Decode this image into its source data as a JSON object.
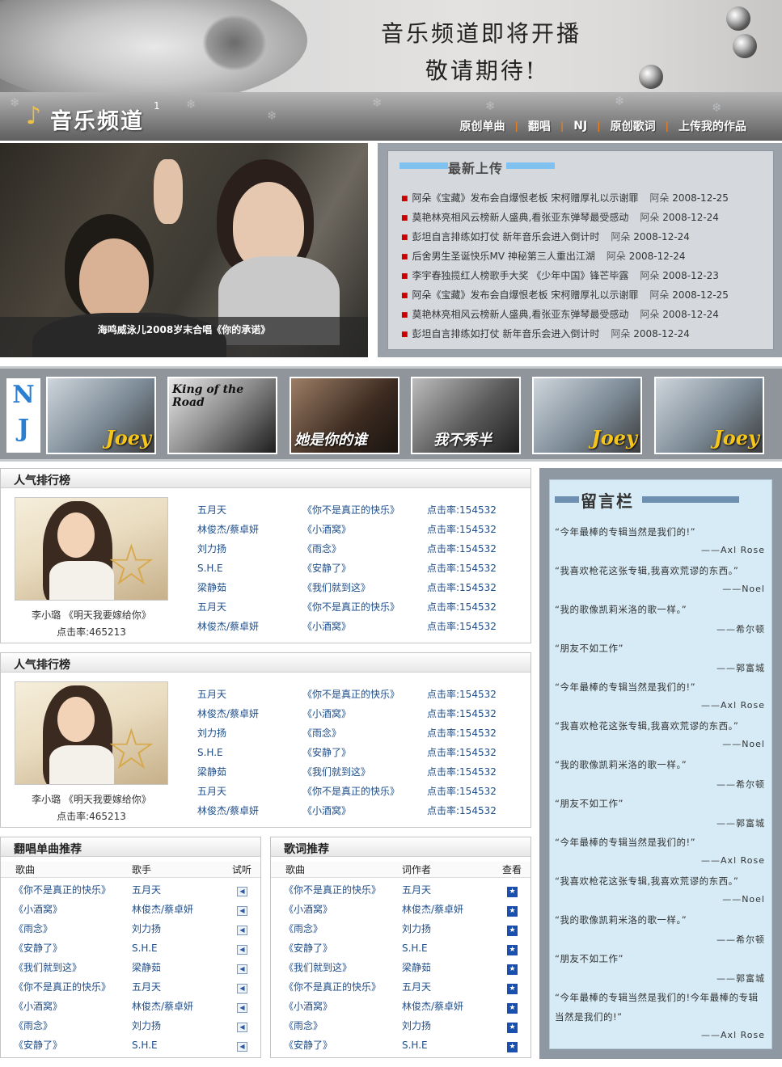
{
  "banner": {
    "line1": "音乐频道即将开播",
    "line2": "敬请期待!"
  },
  "nav": {
    "logo": "音乐频道",
    "logo_sup": "1",
    "links": [
      "原创单曲",
      "翻唱",
      "NJ",
      "原创歌词",
      "上传我的作品"
    ]
  },
  "hero": {
    "caption": "海鸣威泳儿2008岁末合唱《你的承诺》"
  },
  "latest": {
    "title": "最新上传",
    "items": [
      {
        "text": "阿朵《宝藏》发布会自爆恨老板 宋柯赠厚礼以示谢罪",
        "author": "阿朵",
        "date": "2008-12-25"
      },
      {
        "text": "莫艳林亮相风云榜新人盛典,看张亚东弹琴最受感动",
        "author": "阿朵",
        "date": "2008-12-24"
      },
      {
        "text": "彭坦自言排练如打仗 新年音乐会进入倒计时",
        "author": "阿朵",
        "date": "2008-12-24"
      },
      {
        "text": "后舍男生圣诞快乐MV 神秘第三人重出江湖",
        "author": "阿朵",
        "date": "2008-12-24"
      },
      {
        "text": "李宇春独揽红人榜歌手大奖 《少年中国》锋芒毕露",
        "author": "阿朵",
        "date": "2008-12-23"
      },
      {
        "text": "阿朵《宝藏》发布会自爆恨老板 宋柯赠厚礼以示谢罪",
        "author": "阿朵",
        "date": "2008-12-25"
      },
      {
        "text": "莫艳林亮相风云榜新人盛典,看张亚东弹琴最受感动",
        "author": "阿朵",
        "date": "2008-12-24"
      },
      {
        "text": "彭坦自言排练如打仗 新年音乐会进入倒计时",
        "author": "阿朵",
        "date": "2008-12-24"
      }
    ]
  },
  "nj": {
    "label1": "N",
    "label2": "J",
    "thumbs": [
      "Joey",
      "King of the Road",
      "她是你的谁",
      "我不秀半",
      "Joey",
      "Joey"
    ]
  },
  "ranking_panels": [
    {
      "title": "人气排行榜",
      "feature_caption": "李小璐 《明天我要嫁给你》",
      "feature_hits": "点击率:465213",
      "rows": [
        {
          "artist": "五月天",
          "song": "《你不是真正的快乐》",
          "hits": "点击率:154532"
        },
        {
          "artist": "林俊杰/蔡卓妍",
          "song": "《小酒窝》",
          "hits": "点击率:154532"
        },
        {
          "artist": "刘力扬",
          "song": "《雨念》",
          "hits": "点击率:154532"
        },
        {
          "artist": "S.H.E",
          "song": "《安静了》",
          "hits": "点击率:154532"
        },
        {
          "artist": "梁静茹",
          "song": "《我们就到这》",
          "hits": "点击率:154532"
        },
        {
          "artist": "五月天",
          "song": "《你不是真正的快乐》",
          "hits": "点击率:154532"
        },
        {
          "artist": "林俊杰/蔡卓妍",
          "song": "《小酒窝》",
          "hits": "点击率:154532"
        }
      ]
    },
    {
      "title": "人气排行榜",
      "feature_caption": "李小璐 《明天我要嫁给你》",
      "feature_hits": "点击率:465213",
      "rows": [
        {
          "artist": "五月天",
          "song": "《你不是真正的快乐》",
          "hits": "点击率:154532"
        },
        {
          "artist": "林俊杰/蔡卓妍",
          "song": "《小酒窝》",
          "hits": "点击率:154532"
        },
        {
          "artist": "刘力扬",
          "song": "《雨念》",
          "hits": "点击率:154532"
        },
        {
          "artist": "S.H.E",
          "song": "《安静了》",
          "hits": "点击率:154532"
        },
        {
          "artist": "梁静茹",
          "song": "《我们就到这》",
          "hits": "点击率:154532"
        },
        {
          "artist": "五月天",
          "song": "《你不是真正的快乐》",
          "hits": "点击率:154532"
        },
        {
          "artist": "林俊杰/蔡卓妍",
          "song": "《小酒窝》",
          "hits": "点击率:154532"
        }
      ]
    }
  ],
  "cover_table": {
    "title": "翻唱单曲推荐",
    "headers": [
      "歌曲",
      "歌手",
      "试听"
    ],
    "rows": [
      {
        "song": "《你不是真正的快乐》",
        "artist": "五月天"
      },
      {
        "song": "《小酒窝》",
        "artist": "林俊杰/蔡卓妍"
      },
      {
        "song": "《雨念》",
        "artist": "刘力扬"
      },
      {
        "song": "《安静了》",
        "artist": "S.H.E"
      },
      {
        "song": "《我们就到这》",
        "artist": "梁静茹"
      },
      {
        "song": "《你不是真正的快乐》",
        "artist": "五月天"
      },
      {
        "song": "《小酒窝》",
        "artist": "林俊杰/蔡卓妍"
      },
      {
        "song": "《雨念》",
        "artist": "刘力扬"
      },
      {
        "song": "《安静了》",
        "artist": "S.H.E"
      }
    ]
  },
  "lyrics_table": {
    "title": "歌词推荐",
    "headers": [
      "歌曲",
      "词作者",
      "查看"
    ],
    "rows": [
      {
        "song": "《你不是真正的快乐》",
        "author": "五月天"
      },
      {
        "song": "《小酒窝》",
        "author": "林俊杰/蔡卓妍"
      },
      {
        "song": "《雨念》",
        "author": "刘力扬"
      },
      {
        "song": "《安静了》",
        "author": "S.H.E"
      },
      {
        "song": "《我们就到这》",
        "author": "梁静茹"
      },
      {
        "song": "《你不是真正的快乐》",
        "author": "五月天"
      },
      {
        "song": "《小酒窝》",
        "author": "林俊杰/蔡卓妍"
      },
      {
        "song": "《雨念》",
        "author": "刘力扬"
      },
      {
        "song": "《安静了》",
        "author": "S.H.E"
      }
    ]
  },
  "board": {
    "title": "留言栏",
    "messages": [
      {
        "text": "“今年最棒的专辑当然是我们的!”",
        "sig": "——Axl Rose"
      },
      {
        "text": "“我喜欢枪花这张专辑,我喜欢荒谬的东西。”",
        "sig": "——Noel"
      },
      {
        "text": "“我的歌像凯莉米洛的歌一样。”",
        "sig": "——希尔顿"
      },
      {
        "text": "“朋友不如工作”",
        "sig": "——郭富城"
      },
      {
        "text": "“今年最棒的专辑当然是我们的!”",
        "sig": "——Axl Rose"
      },
      {
        "text": "“我喜欢枪花这张专辑,我喜欢荒谬的东西。”",
        "sig": "——Noel"
      },
      {
        "text": "“我的歌像凯莉米洛的歌一样。”",
        "sig": "——希尔顿"
      },
      {
        "text": "“朋友不如工作”",
        "sig": "——郭富城"
      },
      {
        "text": "“今年最棒的专辑当然是我们的!”",
        "sig": "——Axl Rose"
      },
      {
        "text": "“我喜欢枪花这张专辑,我喜欢荒谬的东西。”",
        "sig": "——Noel"
      },
      {
        "text": "“我的歌像凯莉米洛的歌一样。”",
        "sig": "——希尔顿"
      },
      {
        "text": "“朋友不如工作”",
        "sig": "——郭富城"
      },
      {
        "text": "“今年最棒的专辑当然是我们的!今年最棒的专辑当然是我们的!”",
        "sig": "——Axl Rose"
      }
    ]
  },
  "colors": {
    "accent_orange": "#e87d1e",
    "link_blue": "#1f4e8a",
    "list_dot_red": "#cc0000",
    "board_bg": "#d6ebf6"
  }
}
